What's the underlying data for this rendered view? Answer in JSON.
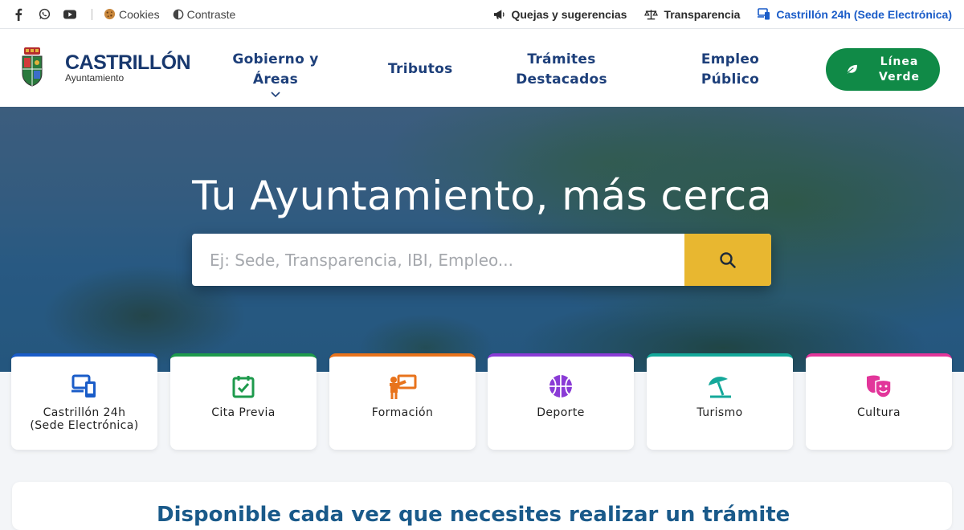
{
  "topbar": {
    "social": [
      {
        "icon": "facebook-icon"
      },
      {
        "icon": "whatsapp-icon"
      },
      {
        "icon": "youtube-icon"
      }
    ],
    "cookies_label": "Cookies",
    "contrast_label": "Contraste",
    "complaints_label": "Quejas y sugerencias",
    "transparency_label": "Transparencia",
    "sede_label": "Castrillón 24h (Sede Electrónica)"
  },
  "header": {
    "logo_title": "CASTRILLÓN",
    "logo_subtitle": "Ayuntamiento",
    "nav": {
      "gobierno": "Gobierno y Áreas",
      "tributos": "Tributos",
      "tramites_1": "Trámites",
      "tramites_2": "Destacados",
      "empleo_1": "Empleo",
      "empleo_2": "Público"
    },
    "linea_verde_1": "Línea",
    "linea_verde_2": "Verde"
  },
  "hero": {
    "title": "Tu Ayuntamiento, más cerca",
    "search_placeholder": "Ej: Sede, Transparencia, IBI, Empleo..."
  },
  "cards": [
    {
      "line1": "Castrillón 24h",
      "line2": "(Sede Electrónica)",
      "color": "#1a5cc8",
      "icon": "devices-icon"
    },
    {
      "line1": "Cita Previa",
      "line2": "",
      "color": "#1e9a4c",
      "icon": "calendar-check-icon"
    },
    {
      "line1": "Formación",
      "line2": "",
      "color": "#e8731c",
      "icon": "teacher-icon"
    },
    {
      "line1": "Deporte",
      "line2": "",
      "color": "#8a3bd6",
      "icon": "basketball-icon"
    },
    {
      "line1": "Turismo",
      "line2": "",
      "color": "#14a89a",
      "icon": "beach-umbrella-icon"
    },
    {
      "line1": "Cultura",
      "line2": "",
      "color": "#e2359a",
      "icon": "theater-masks-icon"
    }
  ],
  "panel": {
    "heading": "Disponible cada vez que necesites realizar un trámite"
  }
}
